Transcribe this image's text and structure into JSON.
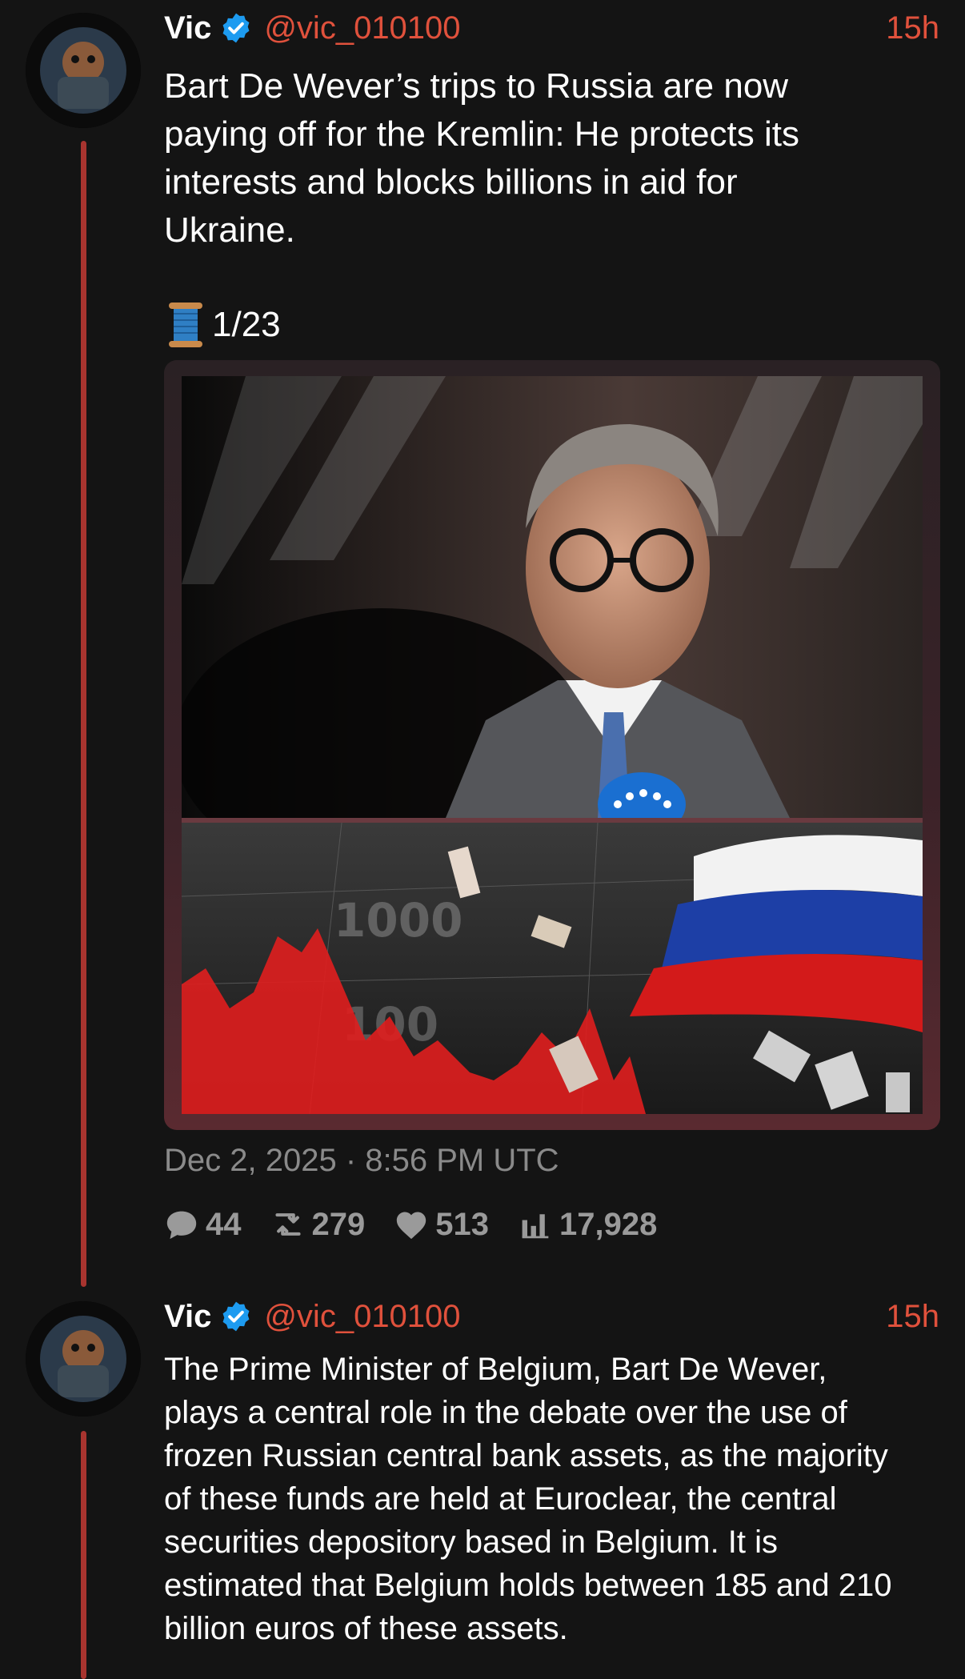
{
  "posts": [
    {
      "author": "Vic",
      "handle": "@vic_010100",
      "time": "15h",
      "text": "Bart De Wever’s trips to Russia are now\npaying off for the Kremlin: He protects its\ninterests and blocks billions in aid for\nUkraine.",
      "thread_counter": "1/23",
      "thread_icon": "spool-of-thread",
      "date": "Dec 2, 2025 · 8:56 PM UTC",
      "stats": {
        "replies": "44",
        "reposts": "279",
        "likes": "513",
        "views": "17,928"
      }
    },
    {
      "author": "Vic",
      "handle": "@vic_010100",
      "time": "15h",
      "text": "The Prime Minister of Belgium, Bart De Wever,\nplays a central role in the debate over the use of\nfrozen Russian central bank assets, as the majority\nof these funds are held at Euroclear, the central\nsecurities depository based in Belgium. It is\nestimated that Belgium holds between 185 and 210\nbillion euros of these assets."
    }
  ],
  "colors": {
    "background": "#141414",
    "accent": "#e0513c",
    "thread_line": "#a8342f",
    "muted": "#8a8a8a",
    "verified": "#1d9bf0"
  },
  "icons": [
    "verified-badge-icon",
    "spool-icon",
    "reply-icon",
    "repost-icon",
    "like-icon",
    "views-icon"
  ]
}
